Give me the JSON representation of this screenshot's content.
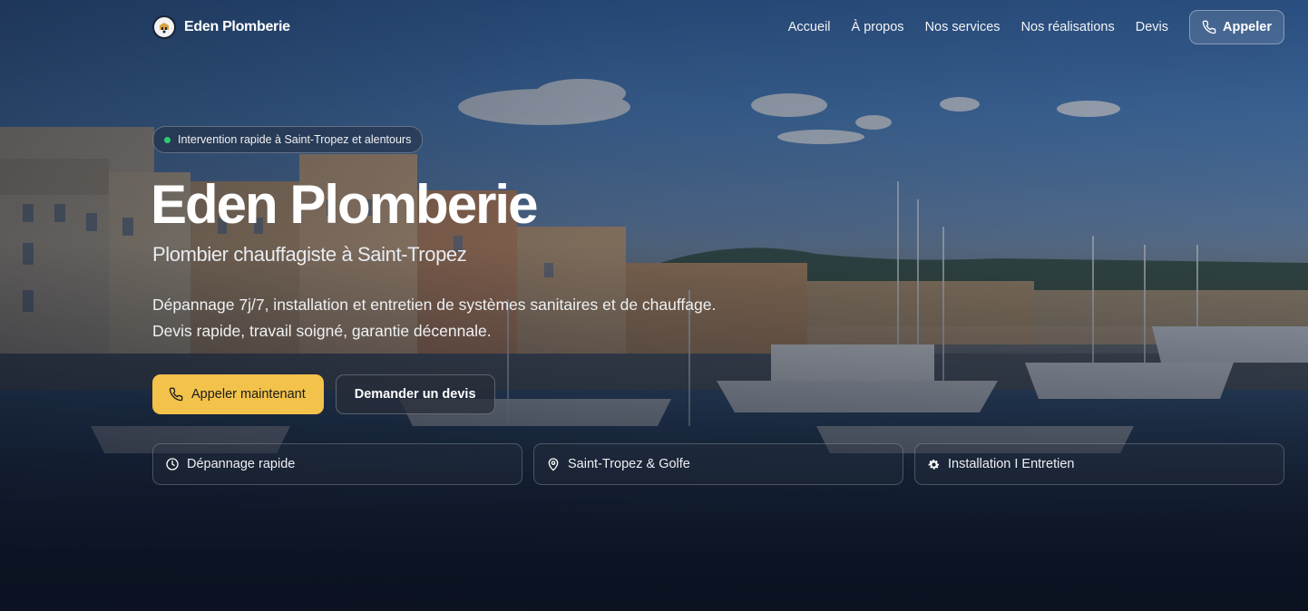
{
  "nav": {
    "brand": "Eden Plomberie",
    "links": [
      "Accueil",
      "À propos",
      "Nos services",
      "Nos réalisations",
      "Devis"
    ],
    "call_label": "Appeler"
  },
  "hero": {
    "badge": "Intervention rapide à Saint-Tropez et alentours",
    "title": "Eden Plomberie",
    "subtitle": "Plombier chauffagiste à Saint-Tropez",
    "description_line1": "Dépannage 7j/7, installation et entretien de systèmes sanitaires et de chauffage.",
    "description_line2": "Devis rapide, travail soigné, garantie décennale.",
    "primary_cta": "Appeler maintenant",
    "secondary_cta": "Demander un devis"
  },
  "features": [
    {
      "icon": "clock-icon",
      "label": "Dépannage rapide"
    },
    {
      "icon": "map-pin-icon",
      "label": "Saint-Tropez & Golfe"
    },
    {
      "icon": "gear-icon",
      "label": "Installation I Entretien"
    }
  ],
  "colors": {
    "accent": "#f2c24b",
    "status_dot": "#2ecc71",
    "overlay": "#0b1220"
  }
}
